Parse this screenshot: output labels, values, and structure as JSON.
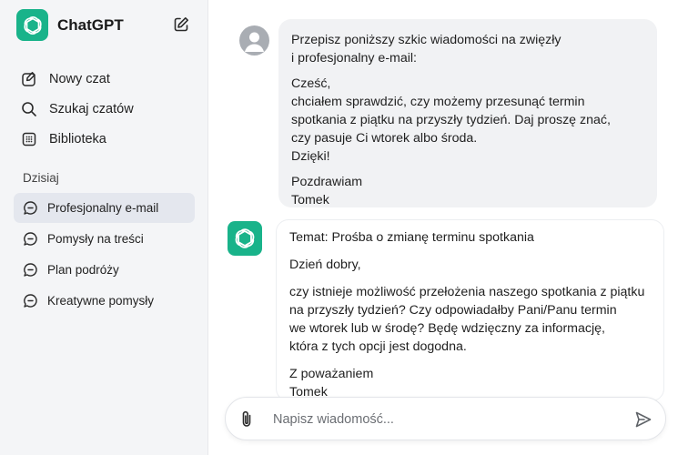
{
  "app": {
    "name": "ChatGPT",
    "accent": "#19b38a"
  },
  "sidebar": {
    "nav": [
      {
        "label": "Nowy czat",
        "icon": "new-chat-icon"
      },
      {
        "label": "Szukaj czatów",
        "icon": "search-icon"
      },
      {
        "label": "Biblioteka",
        "icon": "library-icon"
      }
    ],
    "section_label": "Dzisiaj",
    "history": [
      {
        "label": "Profesjonalny e-mail",
        "active": true
      },
      {
        "label": "Pomysły na treści",
        "active": false
      },
      {
        "label": "Plan podróży",
        "active": false
      },
      {
        "label": "Kreatywne pomysły",
        "active": false
      }
    ]
  },
  "conversation": {
    "user_message": {
      "line1": "Przepisz poniższy szkic wiadomości na zwięzły",
      "line2": "i profesjonalny e-mail:",
      "greeting": "Cześć,",
      "body1": "chciałem sprawdzić, czy możemy przesunąć termin",
      "body2": "spotkania z piątku na przyszły tydzień. Daj proszę znać,",
      "body3": "czy pasuje Ci wtorek albo środa.",
      "thanks": "Dzięki!",
      "signoff": "Pozdrawiam",
      "name": "Tomek"
    },
    "assistant_message": {
      "subject": "Temat: Prośba o zmianę terminu spotkania",
      "greeting": "Dzień dobry,",
      "body1": "czy istnieje możliwość przełożenia naszego spotkania z piątku",
      "body2": "na przyszły tydzień? Czy odpowiadałby Pani/Panu termin",
      "body3": "we wtorek lub w środę? Będę wdzięczny za informację,",
      "body4": "która z tych opcji jest dogodna.",
      "closing": "Z poważaniem",
      "name": "Tomek"
    }
  },
  "composer": {
    "placeholder": "Napisz wiadomość..."
  }
}
